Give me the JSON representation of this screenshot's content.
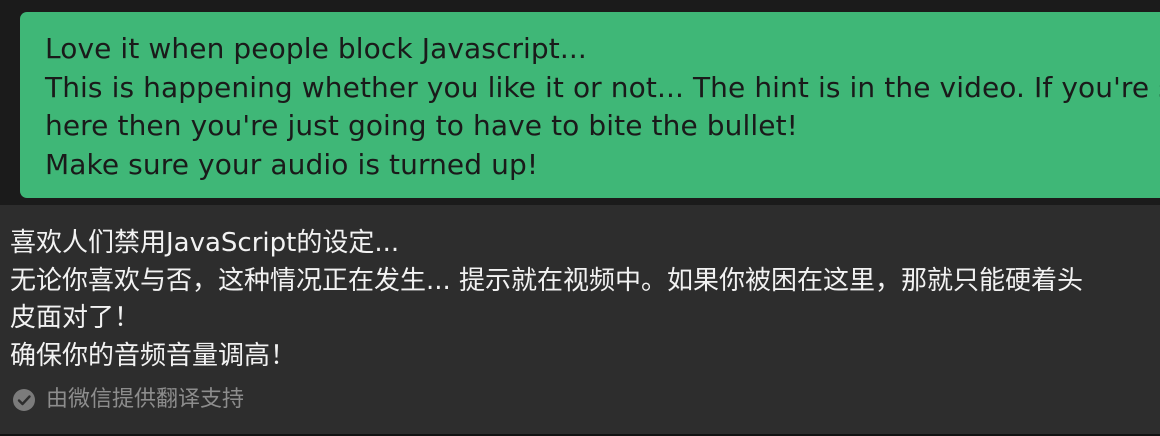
{
  "card": {
    "lines": [
      "Love it when people block Javascript...",
      "This is happening whether you like it or not... The hint is in the video. If you're stuck",
      "here then you're just going to have to bite the bullet!",
      "Make sure your audio is turned up!"
    ],
    "bg_color": "#3fb777",
    "text_color": "#1a1a1a"
  },
  "translation": {
    "lines": [
      "喜欢人们禁用JavaScript的设定...",
      "无论你喜欢与否，这种情况正在发生... 提示就在视频中。如果你被困在这里，那就只能硬着头",
      "皮面对了！",
      "确保你的音频音量调高！"
    ],
    "credit": "由微信提供翻译支持",
    "credit_icon": "check-circle-icon",
    "bg_color": "#2d2d2d",
    "text_color": "#f2f2f2"
  }
}
